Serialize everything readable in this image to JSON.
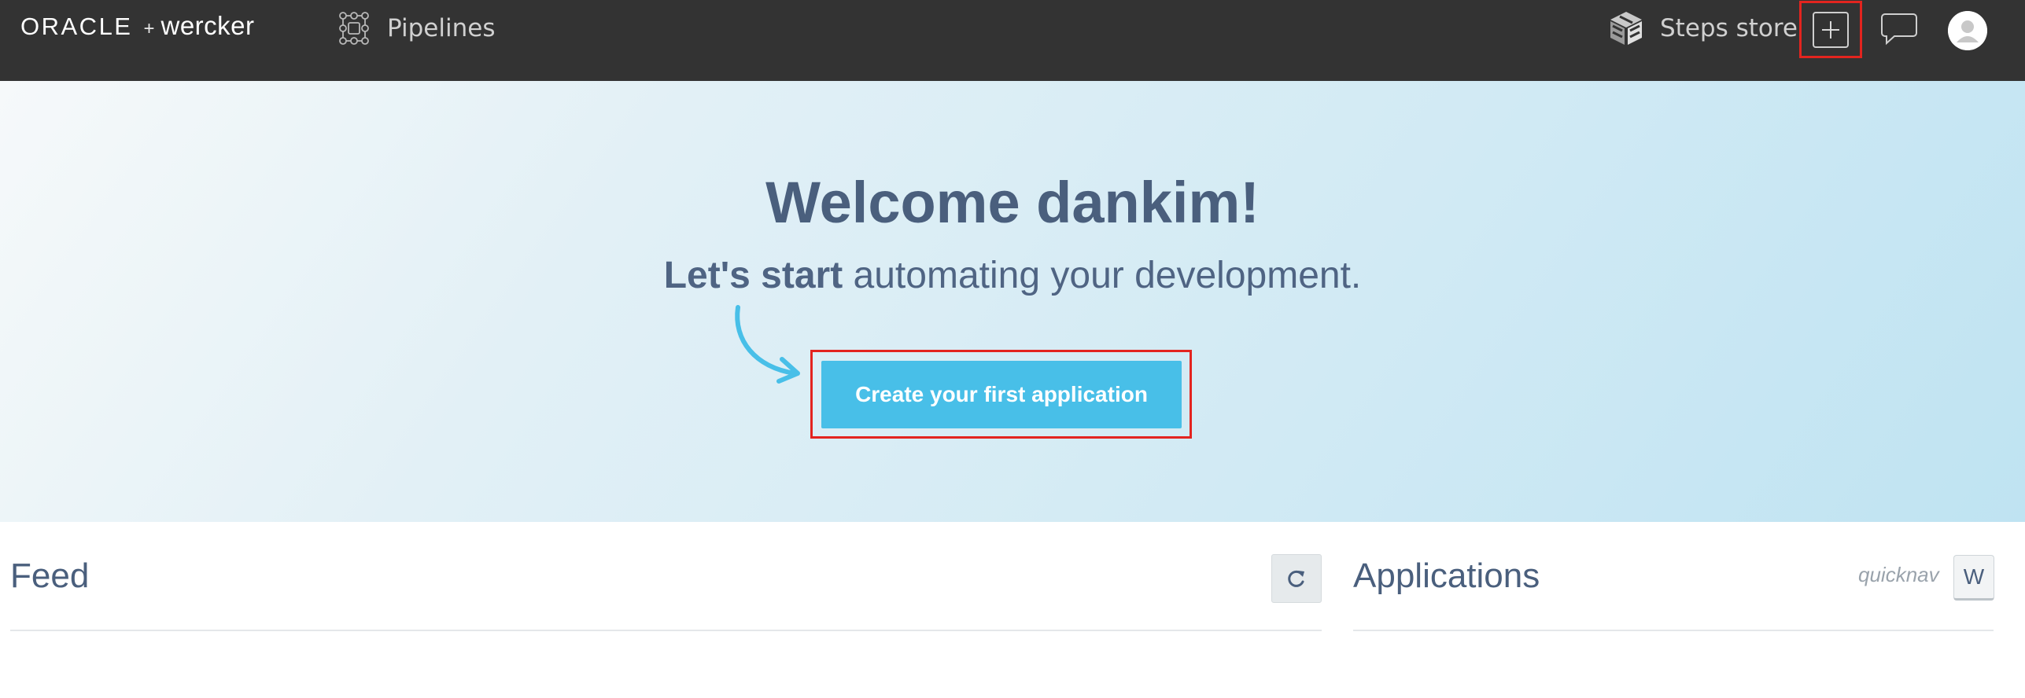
{
  "header": {
    "logo_oracle": "ORACLE",
    "logo_plus": "+",
    "logo_wercker": "wercker",
    "pipelines_label": "Pipelines",
    "steps_store_label": "Steps store",
    "background_color": "#333333"
  },
  "hero": {
    "welcome": "Welcome dankim!",
    "tagline_bold": "Let's start",
    "tagline_rest": " automating your development.",
    "cta_label": "Create your first application",
    "accent_color": "#48bfe8"
  },
  "feed": {
    "title": "Feed",
    "refresh_icon": "refresh-icon"
  },
  "applications": {
    "title": "Applications",
    "quicknav_label": "quicknav",
    "quicknav_key": "W"
  },
  "highlight_color": "#e3241f"
}
